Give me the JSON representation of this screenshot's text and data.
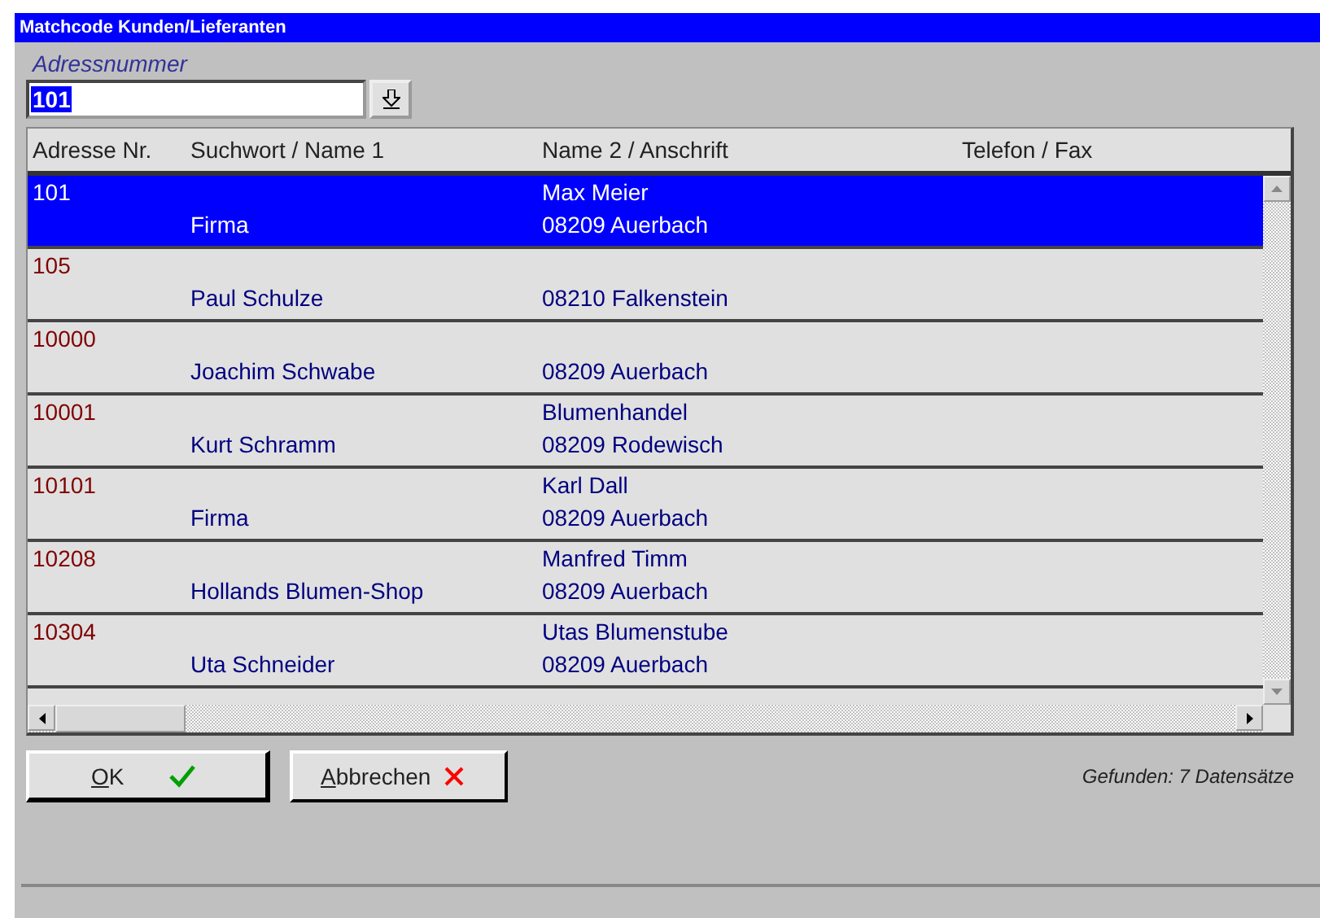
{
  "window": {
    "title": "Matchcode Kunden/Lieferanten"
  },
  "search": {
    "label": "Adressnummer",
    "value": "101"
  },
  "table": {
    "columns": [
      "Adresse Nr.",
      "Suchwort / Name 1",
      "Name 2 / Anschrift",
      "Telefon / Fax"
    ],
    "rows": [
      {
        "number": "101",
        "name1": "Firma",
        "name2": "Max Meier",
        "address": "08209 Auerbach",
        "selected": true
      },
      {
        "number": "105",
        "name1": "Paul Schulze",
        "address": "08210 Falkenstein",
        "selected": false
      },
      {
        "number": "10000",
        "name1": "Joachim Schwabe",
        "address": "08209 Auerbach",
        "selected": false
      },
      {
        "number": "10001",
        "name1": "Kurt Schramm",
        "name2": "Blumenhandel",
        "address": "08209 Rodewisch",
        "selected": false
      },
      {
        "number": "10101",
        "name1": "Firma",
        "name2": "Karl Dall",
        "address": "08209 Auerbach",
        "selected": false
      },
      {
        "number": "10208",
        "name1": "Hollands Blumen-Shop",
        "name2": "Manfred Timm",
        "address": "08209 Auerbach",
        "selected": false
      },
      {
        "number": "10304",
        "name1": "Uta Schneider",
        "name2": "Utas Blumenstube",
        "address": "08209 Auerbach",
        "selected": false
      }
    ]
  },
  "buttons": [
    {
      "label": "OK",
      "kind": "ok"
    },
    {
      "label": "Abbrechen",
      "kind": "cancel"
    }
  ],
  "status": "Gefunden: 7 Datensätze"
}
